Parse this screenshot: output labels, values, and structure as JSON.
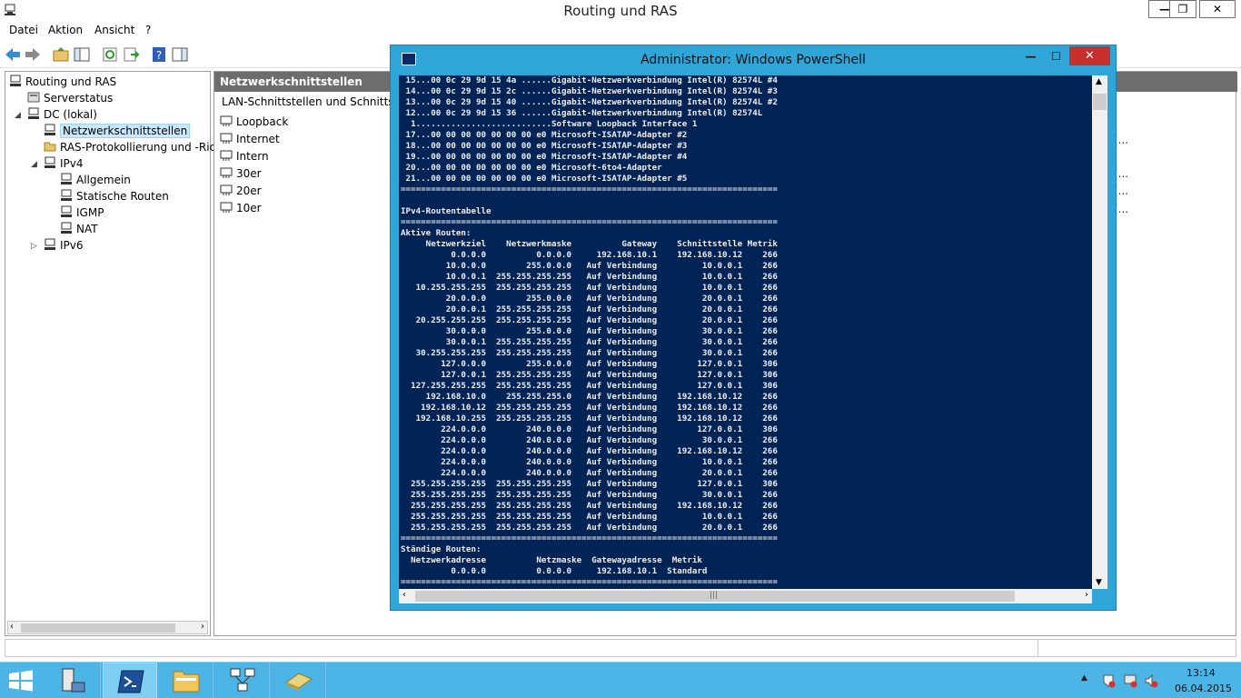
{
  "window": {
    "title": "Routing und RAS",
    "minimize": "—",
    "maximize": "❐",
    "close": "✕"
  },
  "menu": [
    "Datei",
    "Aktion",
    "Ansicht",
    "?"
  ],
  "tree": {
    "root": "Routing und RAS",
    "serverstatus": "Serverstatus",
    "dc": "DC (lokal)",
    "netzwerk": "Netzwerkschnittstellen",
    "ras": "RAS-Protokollierung und -Rich",
    "ipv4": "IPv4",
    "allgemein": "Allgemein",
    "statische": "Statische Routen",
    "igmp": "IGMP",
    "nat": "NAT",
    "ipv6": "IPv6"
  },
  "content": {
    "header": "Netzwerkschnittstellen",
    "column": "LAN-Schnittstellen und Schnittstelle",
    "interfaces": [
      "Loopback",
      "Internet",
      "Intern",
      "30er",
      "20er",
      "10er"
    ],
    "trunc": [
      "(...",
      "(...",
      "(...",
      "(..."
    ]
  },
  "powershell": {
    "title": "Administrator: Windows PowerShell",
    "minimize": "—",
    "maximize": "☐",
    "close": "✕",
    "lines": [
      " 15...00 0c 29 9d 15 4a ......Gigabit-Netzwerkverbindung Intel(R) 82574L #4",
      " 14...00 0c 29 9d 15 2c ......Gigabit-Netzwerkverbindung Intel(R) 82574L #3",
      " 13...00 0c 29 9d 15 40 ......Gigabit-Netzwerkverbindung Intel(R) 82574L #2",
      " 12...00 0c 29 9d 15 36 ......Gigabit-Netzwerkverbindung Intel(R) 82574L",
      "  1...........................Software Loopback Interface 1",
      " 17...00 00 00 00 00 00 00 e0 Microsoft-ISATAP-Adapter #2",
      " 18...00 00 00 00 00 00 00 e0 Microsoft-ISATAP-Adapter #3",
      " 19...00 00 00 00 00 00 00 e0 Microsoft-ISATAP-Adapter #4",
      " 20...00 00 00 00 00 00 00 e0 Microsoft-6to4-Adapter",
      " 21...00 00 00 00 00 00 00 e0 Microsoft-ISATAP-Adapter #5",
      "===========================================================================",
      "",
      "IPv4-Routentabelle",
      "===========================================================================",
      "Aktive Routen:",
      "     Netzwerkziel    Netzwerkmaske          Gateway    Schnittstelle Metrik",
      "          0.0.0.0          0.0.0.0     192.168.10.1    192.168.10.12    266",
      "         10.0.0.0        255.0.0.0   Auf Verbindung         10.0.0.1    266",
      "         10.0.0.1  255.255.255.255   Auf Verbindung         10.0.0.1    266",
      "   10.255.255.255  255.255.255.255   Auf Verbindung         10.0.0.1    266",
      "         20.0.0.0        255.0.0.0   Auf Verbindung         20.0.0.1    266",
      "         20.0.0.1  255.255.255.255   Auf Verbindung         20.0.0.1    266",
      "   20.255.255.255  255.255.255.255   Auf Verbindung         20.0.0.1    266",
      "         30.0.0.0        255.0.0.0   Auf Verbindung         30.0.0.1    266",
      "         30.0.0.1  255.255.255.255   Auf Verbindung         30.0.0.1    266",
      "   30.255.255.255  255.255.255.255   Auf Verbindung         30.0.0.1    266",
      "        127.0.0.0        255.0.0.0   Auf Verbindung        127.0.0.1    306",
      "        127.0.0.1  255.255.255.255   Auf Verbindung        127.0.0.1    306",
      "  127.255.255.255  255.255.255.255   Auf Verbindung        127.0.0.1    306",
      "     192.168.10.0    255.255.255.0   Auf Verbindung    192.168.10.12    266",
      "    192.168.10.12  255.255.255.255   Auf Verbindung    192.168.10.12    266",
      "   192.168.10.255  255.255.255.255   Auf Verbindung    192.168.10.12    266",
      "        224.0.0.0        240.0.0.0   Auf Verbindung        127.0.0.1    306",
      "        224.0.0.0        240.0.0.0   Auf Verbindung         30.0.0.1    266",
      "        224.0.0.0        240.0.0.0   Auf Verbindung    192.168.10.12    266",
      "        224.0.0.0        240.0.0.0   Auf Verbindung         10.0.0.1    266",
      "        224.0.0.0        240.0.0.0   Auf Verbindung         20.0.0.1    266",
      "  255.255.255.255  255.255.255.255   Auf Verbindung        127.0.0.1    306",
      "  255.255.255.255  255.255.255.255   Auf Verbindung         30.0.0.1    266",
      "  255.255.255.255  255.255.255.255   Auf Verbindung    192.168.10.12    266",
      "  255.255.255.255  255.255.255.255   Auf Verbindung         10.0.0.1    266",
      "  255.255.255.255  255.255.255.255   Auf Verbindung         20.0.0.1    266",
      "===========================================================================",
      "Ständige Routen:",
      "  Netzwerkadresse          Netzmaske  Gatewayadresse  Metrik",
      "          0.0.0.0          0.0.0.0     192.168.10.1  Standard",
      "==========================================================================="
    ]
  },
  "clock": {
    "time": "13:14",
    "date": "06.04.2015"
  },
  "colors": {
    "console_bg": "#012456",
    "console_fg": "#eeedf0",
    "ps_frame": "#2fa5d8",
    "taskbar": "#4cb5e6",
    "close_red": "#c7302b",
    "header_gray": "#6d6d6d"
  },
  "icons": [
    "windows-start-icon",
    "server-manager-icon",
    "powershell-icon",
    "explorer-icon",
    "network-icon",
    "tools-icon"
  ]
}
